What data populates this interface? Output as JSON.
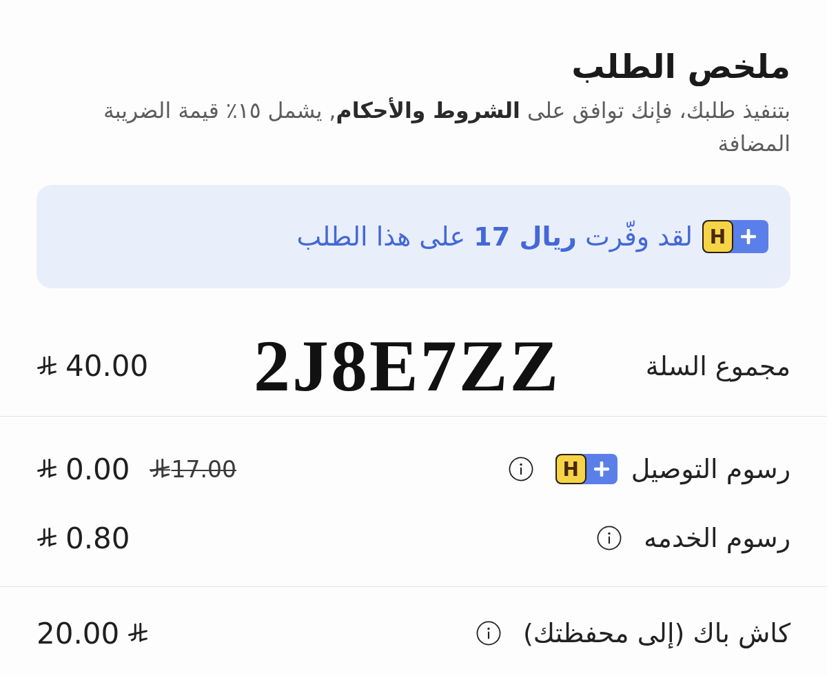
{
  "header": {
    "title": "ملخص الطلب",
    "subtitle": {
      "before": "بتنفيذ طلبك، فإنك توافق على",
      "link": "الشروط والأحكام",
      "after": ", يشمل ١٥٪ قيمة الضريبة المضافة"
    }
  },
  "savings_banner": {
    "badge_letter": "H",
    "text": "لقد وفّرت **ريال 17** على هذا الطلب"
  },
  "overlay_code": "2J8E7ZZ",
  "sections": [
    {
      "rows": [
        {
          "label": "مجموع السلة",
          "info": false,
          "value": "40.00",
          "sign_after": false
        }
      ]
    },
    {
      "rows": [
        {
          "label": "رسوم التوصيل",
          "badge_letter": "H",
          "info": true,
          "value": "0.00",
          "old_value": "17.00",
          "sign_after": false
        },
        {
          "label": "رسوم الخدمه",
          "info": true,
          "value": "0.80",
          "sign_after": false
        }
      ]
    },
    {
      "rows": [
        {
          "label": "كاش باك (إلى محفظتك)",
          "info": true,
          "value": "20.00",
          "sign_after": true
        }
      ]
    }
  ]
}
